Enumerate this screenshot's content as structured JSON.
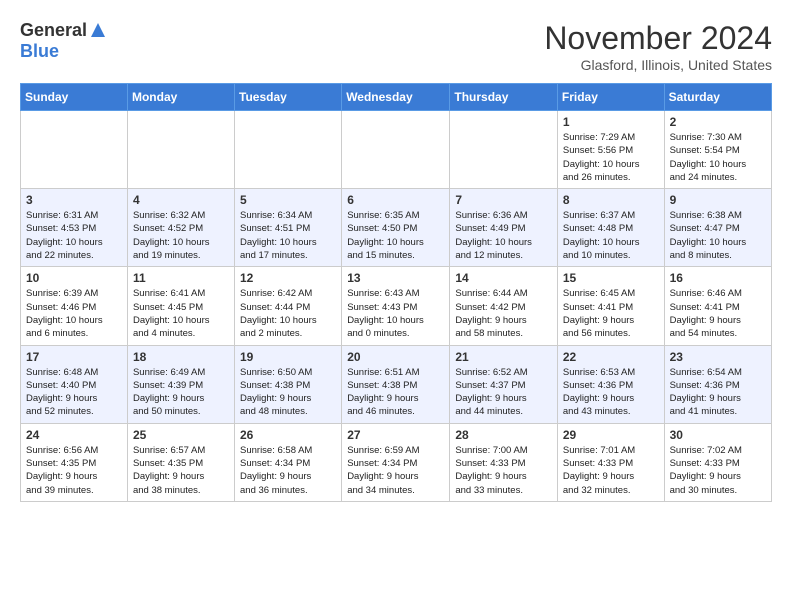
{
  "header": {
    "logo_general": "General",
    "logo_blue": "Blue",
    "title": "November 2024",
    "location": "Glasford, Illinois, United States"
  },
  "days_of_week": [
    "Sunday",
    "Monday",
    "Tuesday",
    "Wednesday",
    "Thursday",
    "Friday",
    "Saturday"
  ],
  "weeks": [
    {
      "days": [
        {
          "num": "",
          "info": ""
        },
        {
          "num": "",
          "info": ""
        },
        {
          "num": "",
          "info": ""
        },
        {
          "num": "",
          "info": ""
        },
        {
          "num": "",
          "info": ""
        },
        {
          "num": "1",
          "info": "Sunrise: 7:29 AM\nSunset: 5:56 PM\nDaylight: 10 hours\nand 26 minutes."
        },
        {
          "num": "2",
          "info": "Sunrise: 7:30 AM\nSunset: 5:54 PM\nDaylight: 10 hours\nand 24 minutes."
        }
      ]
    },
    {
      "days": [
        {
          "num": "3",
          "info": "Sunrise: 6:31 AM\nSunset: 4:53 PM\nDaylight: 10 hours\nand 22 minutes."
        },
        {
          "num": "4",
          "info": "Sunrise: 6:32 AM\nSunset: 4:52 PM\nDaylight: 10 hours\nand 19 minutes."
        },
        {
          "num": "5",
          "info": "Sunrise: 6:34 AM\nSunset: 4:51 PM\nDaylight: 10 hours\nand 17 minutes."
        },
        {
          "num": "6",
          "info": "Sunrise: 6:35 AM\nSunset: 4:50 PM\nDaylight: 10 hours\nand 15 minutes."
        },
        {
          "num": "7",
          "info": "Sunrise: 6:36 AM\nSunset: 4:49 PM\nDaylight: 10 hours\nand 12 minutes."
        },
        {
          "num": "8",
          "info": "Sunrise: 6:37 AM\nSunset: 4:48 PM\nDaylight: 10 hours\nand 10 minutes."
        },
        {
          "num": "9",
          "info": "Sunrise: 6:38 AM\nSunset: 4:47 PM\nDaylight: 10 hours\nand 8 minutes."
        }
      ]
    },
    {
      "days": [
        {
          "num": "10",
          "info": "Sunrise: 6:39 AM\nSunset: 4:46 PM\nDaylight: 10 hours\nand 6 minutes."
        },
        {
          "num": "11",
          "info": "Sunrise: 6:41 AM\nSunset: 4:45 PM\nDaylight: 10 hours\nand 4 minutes."
        },
        {
          "num": "12",
          "info": "Sunrise: 6:42 AM\nSunset: 4:44 PM\nDaylight: 10 hours\nand 2 minutes."
        },
        {
          "num": "13",
          "info": "Sunrise: 6:43 AM\nSunset: 4:43 PM\nDaylight: 10 hours\nand 0 minutes."
        },
        {
          "num": "14",
          "info": "Sunrise: 6:44 AM\nSunset: 4:42 PM\nDaylight: 9 hours\nand 58 minutes."
        },
        {
          "num": "15",
          "info": "Sunrise: 6:45 AM\nSunset: 4:41 PM\nDaylight: 9 hours\nand 56 minutes."
        },
        {
          "num": "16",
          "info": "Sunrise: 6:46 AM\nSunset: 4:41 PM\nDaylight: 9 hours\nand 54 minutes."
        }
      ]
    },
    {
      "days": [
        {
          "num": "17",
          "info": "Sunrise: 6:48 AM\nSunset: 4:40 PM\nDaylight: 9 hours\nand 52 minutes."
        },
        {
          "num": "18",
          "info": "Sunrise: 6:49 AM\nSunset: 4:39 PM\nDaylight: 9 hours\nand 50 minutes."
        },
        {
          "num": "19",
          "info": "Sunrise: 6:50 AM\nSunset: 4:38 PM\nDaylight: 9 hours\nand 48 minutes."
        },
        {
          "num": "20",
          "info": "Sunrise: 6:51 AM\nSunset: 4:38 PM\nDaylight: 9 hours\nand 46 minutes."
        },
        {
          "num": "21",
          "info": "Sunrise: 6:52 AM\nSunset: 4:37 PM\nDaylight: 9 hours\nand 44 minutes."
        },
        {
          "num": "22",
          "info": "Sunrise: 6:53 AM\nSunset: 4:36 PM\nDaylight: 9 hours\nand 43 minutes."
        },
        {
          "num": "23",
          "info": "Sunrise: 6:54 AM\nSunset: 4:36 PM\nDaylight: 9 hours\nand 41 minutes."
        }
      ]
    },
    {
      "days": [
        {
          "num": "24",
          "info": "Sunrise: 6:56 AM\nSunset: 4:35 PM\nDaylight: 9 hours\nand 39 minutes."
        },
        {
          "num": "25",
          "info": "Sunrise: 6:57 AM\nSunset: 4:35 PM\nDaylight: 9 hours\nand 38 minutes."
        },
        {
          "num": "26",
          "info": "Sunrise: 6:58 AM\nSunset: 4:34 PM\nDaylight: 9 hours\nand 36 minutes."
        },
        {
          "num": "27",
          "info": "Sunrise: 6:59 AM\nSunset: 4:34 PM\nDaylight: 9 hours\nand 34 minutes."
        },
        {
          "num": "28",
          "info": "Sunrise: 7:00 AM\nSunset: 4:33 PM\nDaylight: 9 hours\nand 33 minutes."
        },
        {
          "num": "29",
          "info": "Sunrise: 7:01 AM\nSunset: 4:33 PM\nDaylight: 9 hours\nand 32 minutes."
        },
        {
          "num": "30",
          "info": "Sunrise: 7:02 AM\nSunset: 4:33 PM\nDaylight: 9 hours\nand 30 minutes."
        }
      ]
    }
  ]
}
